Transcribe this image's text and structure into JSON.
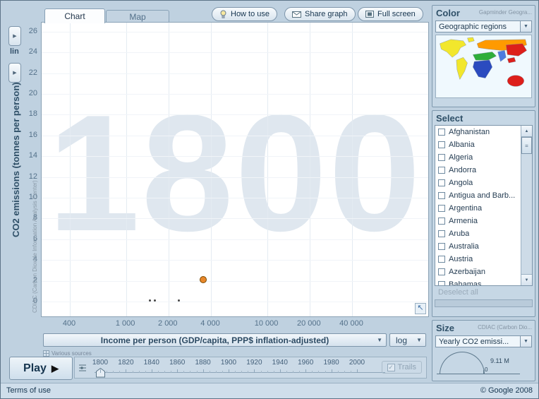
{
  "tabs": {
    "chart": "Chart",
    "map": "Map"
  },
  "toolbar": {
    "how_to_use": "How to use",
    "share_graph": "Share graph",
    "full_screen": "Full screen"
  },
  "chart": {
    "y_source": "CDIAC (Carbon Dioxide Information Analysis Center)",
    "y_scale": "lin",
    "x_scale": "log",
    "sources_note": "Various sources"
  },
  "chart_data": {
    "type": "scatter",
    "year": "1800",
    "xlabel": "Income per person (GDP/capita, PPP$ inflation-adjusted)",
    "ylabel": "CO2 emissions (tonnes per person)",
    "x_scale": "log",
    "y_scale": "linear",
    "x_ticks": [
      400,
      1000,
      2000,
      4000,
      10000,
      20000,
      40000
    ],
    "x_tick_labels": [
      "400",
      "1 000",
      "2 000",
      "4 000",
      "10 000",
      "20 000",
      "40 000"
    ],
    "y_ticks": [
      0,
      2,
      4,
      6,
      8,
      10,
      12,
      14,
      16,
      18,
      20,
      22,
      24,
      26
    ],
    "ylim": [
      0,
      27
    ],
    "points": [
      {
        "x": 3500,
        "y": 2.2,
        "r": 4,
        "color": "#e8872a",
        "outline": "#7a4a00",
        "note": "highlighted bubble"
      },
      {
        "x": 1470,
        "y": 0.1,
        "r": 1.5,
        "color": "#444444"
      },
      {
        "x": 1600,
        "y": 0.1,
        "r": 1.5,
        "color": "#444444"
      },
      {
        "x": 2380,
        "y": 0.1,
        "r": 1.5,
        "color": "#444444"
      }
    ]
  },
  "timeline": {
    "play": "Play",
    "years": [
      "1800",
      "1820",
      "1840",
      "1860",
      "1880",
      "1900",
      "1920",
      "1940",
      "1960",
      "1980",
      "2000"
    ],
    "current_year": "1800",
    "trails": "Trails",
    "trails_checked": true
  },
  "color_panel": {
    "title": "Color",
    "source": "Gapminder Geogra...",
    "indicator": "Geographic regions",
    "region_colors": {
      "america": "#f2e72c",
      "europe_central_asia": "#ff9a00",
      "east_asia_pacific": "#dd1f1a",
      "middle_east_north_africa": "#2fae3a",
      "south_asia": "#4d7ae0",
      "sub_saharan_africa": "#2b4bbf"
    }
  },
  "select_panel": {
    "title": "Select",
    "countries": [
      "Afghanistan",
      "Albania",
      "Algeria",
      "Andorra",
      "Angola",
      "Antigua and Barb...",
      "Argentina",
      "Armenia",
      "Aruba",
      "Australia",
      "Austria",
      "Azerbaijan",
      "Bahamas"
    ],
    "deselect_all": "Deselect all"
  },
  "size_panel": {
    "title": "Size",
    "source": "CDIAC (Carbon Dio...",
    "indicator": "Yearly CO2 emissi...",
    "max_label": "9.11 M",
    "zero_label": "0"
  },
  "footer": {
    "terms": "Terms of use",
    "copyright": "© Google 2008"
  }
}
